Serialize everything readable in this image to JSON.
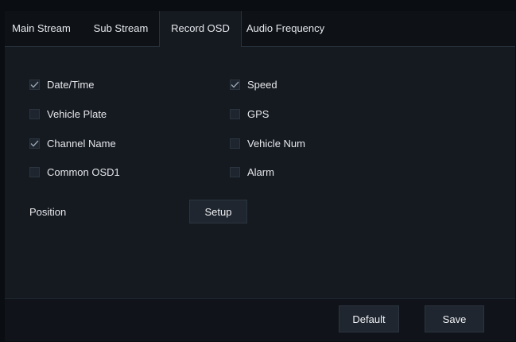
{
  "tabs": [
    "Main Stream",
    "Sub Stream",
    "Record OSD",
    "Audio Frequency"
  ],
  "active_tab": 2,
  "options": {
    "date_time": {
      "label": "Date/Time",
      "checked": true
    },
    "speed": {
      "label": "Speed",
      "checked": true
    },
    "vehicle_plate": {
      "label": "Vehicle Plate",
      "checked": false
    },
    "gps": {
      "label": "GPS",
      "checked": false
    },
    "channel_name": {
      "label": "Channel Name",
      "checked": true
    },
    "vehicle_num": {
      "label": "Vehicle Num",
      "checked": false
    },
    "common_osd1": {
      "label": "Common OSD1",
      "checked": false
    },
    "alarm": {
      "label": "Alarm",
      "checked": false
    }
  },
  "position": {
    "label": "Position",
    "setup_label": "Setup"
  },
  "footer": {
    "default_label": "Default",
    "save_label": "Save"
  },
  "colors": {
    "check": "#9aa6b5",
    "background": "#151a20",
    "tab_bar": "#0e1217"
  }
}
